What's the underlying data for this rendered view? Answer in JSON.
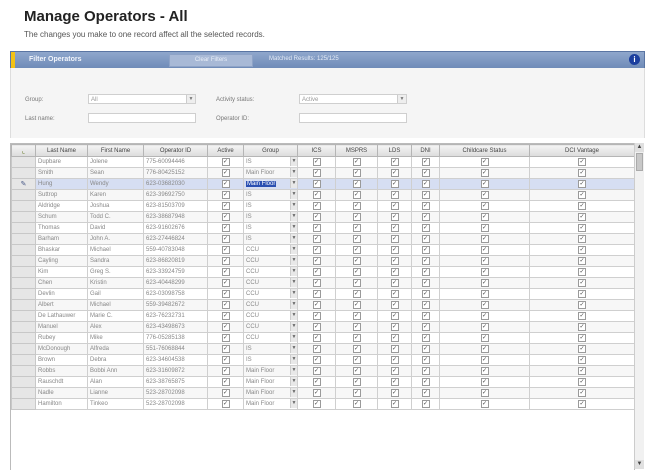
{
  "header": {
    "title": "Manage Operators - All",
    "subtitle": "The changes you make to one record affect all the selected records."
  },
  "filterbar": {
    "label": "Filter Operators",
    "clear_label": "Clear Filters",
    "results": "Matched Results: 125/125",
    "help_icon": "info-icon",
    "accent": "#f3c215",
    "bar_color": "#7b95c0"
  },
  "filters": {
    "group_label": "Group:",
    "group_value": "All",
    "activity_label": "Activity status:",
    "activity_value": "Active",
    "lastname_label": "Last name:",
    "lastname_value": "",
    "operatorid_label": "Operator ID:",
    "operatorid_value": ""
  },
  "grid": {
    "columns": [
      "Last Name",
      "First Name",
      "Operator ID",
      "Active",
      "Group",
      "ICS",
      "MSPRS",
      "LDS",
      "DNI",
      "Childcare Status",
      "DCI Vantage"
    ],
    "rows": [
      {
        "last": "Dupbare",
        "first": "Jolene",
        "id": "775-60094446",
        "group": "IS",
        "checks": [
          1,
          1,
          1,
          1,
          1,
          1,
          1,
          1
        ]
      },
      {
        "last": "Smith",
        "first": "Sean",
        "id": "776-80425152",
        "group": "Main Floor",
        "checks": [
          1,
          1,
          1,
          1,
          1,
          1,
          1,
          1
        ]
      },
      {
        "last": "Hung",
        "first": "Wendy",
        "id": "623-03682030",
        "group": "Main Floor",
        "checks": [
          1,
          1,
          1,
          1,
          1,
          1,
          1,
          1
        ],
        "selected": true
      },
      {
        "last": "Suttrop",
        "first": "Karen",
        "id": "623-39692750",
        "group": "IS",
        "checks": [
          1,
          1,
          1,
          1,
          1,
          1,
          1,
          1
        ]
      },
      {
        "last": "Aldridge",
        "first": "Joshua",
        "id": "623-81503709",
        "group": "IS",
        "checks": [
          1,
          1,
          1,
          1,
          1,
          1,
          1,
          1
        ]
      },
      {
        "last": "Schum",
        "first": "Todd C.",
        "id": "623-38687948",
        "group": "IS",
        "checks": [
          1,
          1,
          1,
          1,
          1,
          1,
          1,
          1
        ]
      },
      {
        "last": "Thomas",
        "first": "David",
        "id": "623-91602676",
        "group": "IS",
        "checks": [
          1,
          1,
          1,
          1,
          1,
          1,
          1,
          1
        ]
      },
      {
        "last": "Barham",
        "first": "John A.",
        "id": "623-27446824",
        "group": "IS",
        "checks": [
          1,
          1,
          1,
          1,
          1,
          1,
          1,
          1
        ]
      },
      {
        "last": "Bhaskar",
        "first": "Michael",
        "id": "559-40783048",
        "group": "CCU",
        "checks": [
          1,
          1,
          1,
          1,
          1,
          1,
          1,
          1
        ]
      },
      {
        "last": "Cayling",
        "first": "Sandra",
        "id": "623-86820819",
        "group": "CCU",
        "checks": [
          1,
          1,
          1,
          1,
          1,
          1,
          1,
          1
        ]
      },
      {
        "last": "Kim",
        "first": "Greg S.",
        "id": "623-33924759",
        "group": "CCU",
        "checks": [
          1,
          1,
          1,
          1,
          1,
          1,
          1,
          1
        ]
      },
      {
        "last": "Chen",
        "first": "Kristin",
        "id": "623-40448299",
        "group": "CCU",
        "checks": [
          1,
          1,
          1,
          1,
          1,
          1,
          1,
          1
        ]
      },
      {
        "last": "Devlin",
        "first": "Gail",
        "id": "623-03098758",
        "group": "CCU",
        "checks": [
          1,
          1,
          1,
          1,
          1,
          1,
          1,
          1
        ]
      },
      {
        "last": "Albert",
        "first": "Michael",
        "id": "559-39482672",
        "group": "CCU",
        "checks": [
          1,
          1,
          1,
          1,
          1,
          1,
          1,
          1
        ]
      },
      {
        "last": "De Lathauwer",
        "first": "Marie C.",
        "id": "623-76232731",
        "group": "CCU",
        "checks": [
          1,
          1,
          1,
          1,
          1,
          1,
          1,
          1
        ]
      },
      {
        "last": "Manuel",
        "first": "Alex",
        "id": "623-43498673",
        "group": "CCU",
        "checks": [
          1,
          1,
          1,
          1,
          1,
          1,
          1,
          1
        ]
      },
      {
        "last": "Rubey",
        "first": "Mike",
        "id": "776-05285138",
        "group": "CCU",
        "checks": [
          1,
          1,
          1,
          1,
          1,
          1,
          1,
          1
        ]
      },
      {
        "last": "McDonough",
        "first": "Alfreda",
        "id": "551-76068844",
        "group": "IS",
        "checks": [
          1,
          1,
          1,
          1,
          1,
          1,
          1,
          1
        ]
      },
      {
        "last": "Brown",
        "first": "Debra",
        "id": "623-34604538",
        "group": "IS",
        "checks": [
          1,
          1,
          1,
          1,
          1,
          1,
          1,
          1
        ]
      },
      {
        "last": "Robbs",
        "first": "Bobbi Ann",
        "id": "623-31609872",
        "group": "Main Floor",
        "checks": [
          1,
          1,
          1,
          1,
          1,
          1,
          1,
          1
        ]
      },
      {
        "last": "Rauschdt",
        "first": "Alan",
        "id": "623-38765875",
        "group": "Main Floor",
        "checks": [
          1,
          1,
          1,
          1,
          1,
          1,
          1,
          1
        ]
      },
      {
        "last": "Nadle",
        "first": "Lianne",
        "id": "523-28702098",
        "group": "Main Floor",
        "checks": [
          1,
          1,
          1,
          1,
          1,
          1,
          1,
          1
        ]
      },
      {
        "last": "Hamilton",
        "first": "Tinkeo",
        "id": "523-28702098",
        "group": "Main Floor",
        "checks": [
          1,
          1,
          1,
          1,
          1,
          1,
          1,
          1
        ]
      }
    ]
  }
}
